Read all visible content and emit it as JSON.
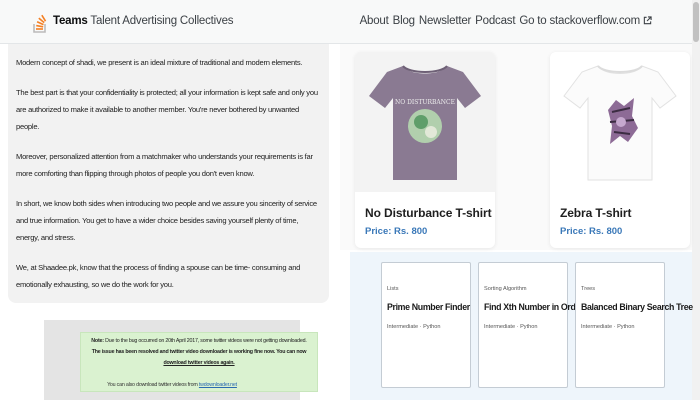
{
  "header": {
    "brand_strong": "Teams",
    "brand_rest": "Talent Advertising Collectives",
    "links": [
      "About",
      "Blog",
      "Newsletter",
      "Podcast",
      "Go to stackoverflow.com"
    ]
  },
  "article": {
    "paragraphs": [
      "Modern concept of shadi, we present is an ideal mixture of traditional and modern elements.",
      "The best part is that your confidentiality is protected; all your information is kept safe and only you are authorized to make it available to another member. You're never bothered by unwanted people.",
      "Moreover, personalized attention from a matchmaker who understands your requirements is far more comforting than flipping through photos of people you don't even know.",
      "In short, we know both sides when introducing two people and we assure you sincerity of service and true information. You get to have a wider choice besides saving yourself plenty of time, energy, and stress.",
      "We, at Shaadee.pk, know that the process of finding a spouse can be time- consuming and emotionally exhausting, so we do the work for you."
    ]
  },
  "notice": {
    "note_label": "Note:",
    "line1": "Due to the bug occurred on 20th April 2017, some twitter videos were not getting downloaded.",
    "line2": "The issue has been resolved and twitter video downloader is working fine now. You can now",
    "line3": "download twitter videos again.",
    "footer_text": "You can also download twitter videos from",
    "footer_link": "twdownloader.net"
  },
  "products": [
    {
      "name": "No Disturbance T-shirt",
      "price": "Price: Rs. 800",
      "shirt_color": "#8a7a92",
      "graphic_text": "NO DISTURBANCE"
    },
    {
      "name": "Zebra T-shirt",
      "price": "Price: Rs. 800",
      "shirt_color": "#fbfbfb"
    }
  ],
  "problems": [
    {
      "category": "Lists",
      "title": "Prime Number Finder",
      "level": "Intermediate · Python"
    },
    {
      "category": "Sorting Algorithm",
      "title": "Find Xth Number in Order",
      "level": "Intermediate · Python"
    },
    {
      "category": "Trees",
      "title": "Balanced Binary Search Tree",
      "level": "Intermediate · Python"
    }
  ],
  "colors": {
    "price": "#3a78b8",
    "notice_bg": "#daf2d0",
    "logo_orange": "#f48024",
    "logo_gray": "#bcbbbb"
  }
}
